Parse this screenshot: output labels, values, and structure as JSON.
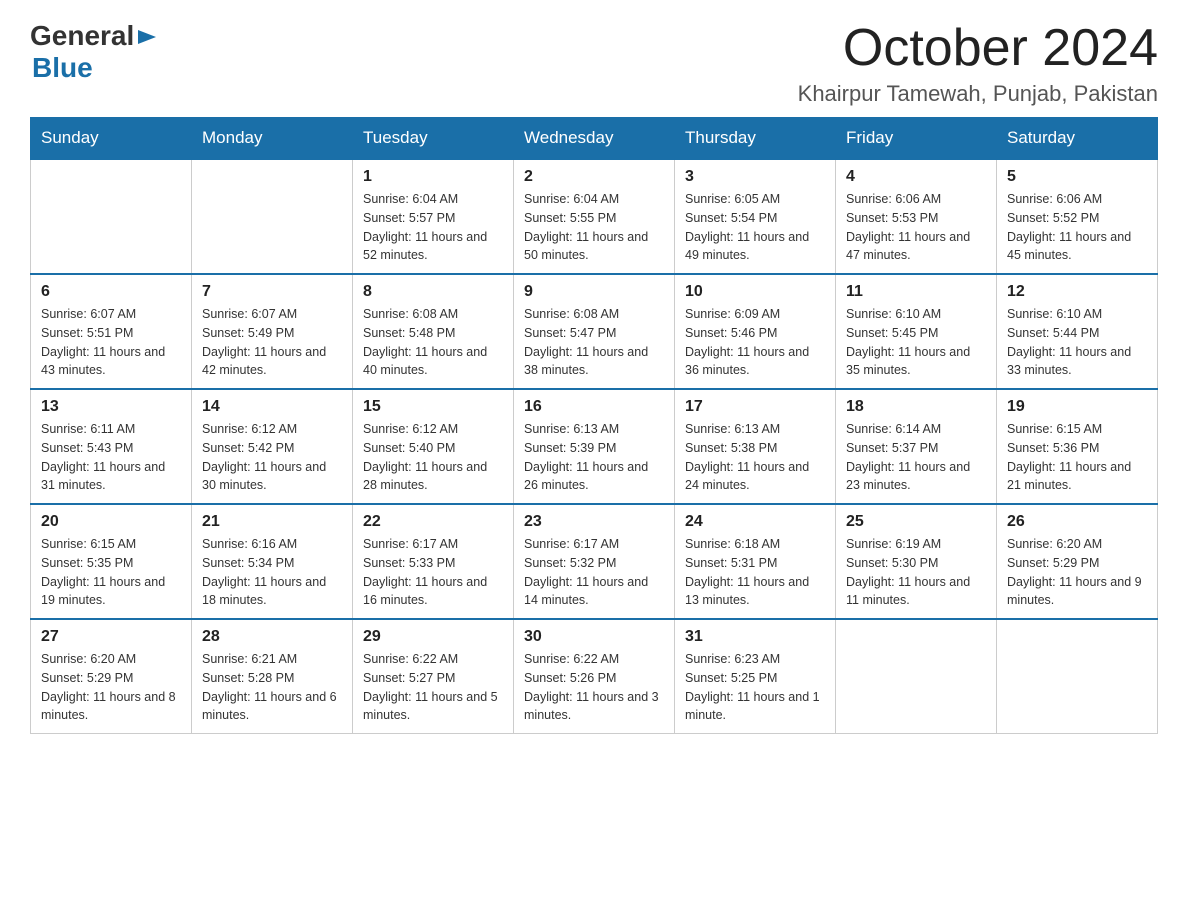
{
  "header": {
    "logo": {
      "general": "General",
      "arrow": "▶",
      "blue": "Blue"
    },
    "title": "October 2024",
    "location": "Khairpur Tamewah, Punjab, Pakistan"
  },
  "weekdays": [
    "Sunday",
    "Monday",
    "Tuesday",
    "Wednesday",
    "Thursday",
    "Friday",
    "Saturday"
  ],
  "weeks": [
    [
      {
        "day": "",
        "sunrise": "",
        "sunset": "",
        "daylight": ""
      },
      {
        "day": "",
        "sunrise": "",
        "sunset": "",
        "daylight": ""
      },
      {
        "day": "1",
        "sunrise": "Sunrise: 6:04 AM",
        "sunset": "Sunset: 5:57 PM",
        "daylight": "Daylight: 11 hours and 52 minutes."
      },
      {
        "day": "2",
        "sunrise": "Sunrise: 6:04 AM",
        "sunset": "Sunset: 5:55 PM",
        "daylight": "Daylight: 11 hours and 50 minutes."
      },
      {
        "day": "3",
        "sunrise": "Sunrise: 6:05 AM",
        "sunset": "Sunset: 5:54 PM",
        "daylight": "Daylight: 11 hours and 49 minutes."
      },
      {
        "day": "4",
        "sunrise": "Sunrise: 6:06 AM",
        "sunset": "Sunset: 5:53 PM",
        "daylight": "Daylight: 11 hours and 47 minutes."
      },
      {
        "day": "5",
        "sunrise": "Sunrise: 6:06 AM",
        "sunset": "Sunset: 5:52 PM",
        "daylight": "Daylight: 11 hours and 45 minutes."
      }
    ],
    [
      {
        "day": "6",
        "sunrise": "Sunrise: 6:07 AM",
        "sunset": "Sunset: 5:51 PM",
        "daylight": "Daylight: 11 hours and 43 minutes."
      },
      {
        "day": "7",
        "sunrise": "Sunrise: 6:07 AM",
        "sunset": "Sunset: 5:49 PM",
        "daylight": "Daylight: 11 hours and 42 minutes."
      },
      {
        "day": "8",
        "sunrise": "Sunrise: 6:08 AM",
        "sunset": "Sunset: 5:48 PM",
        "daylight": "Daylight: 11 hours and 40 minutes."
      },
      {
        "day": "9",
        "sunrise": "Sunrise: 6:08 AM",
        "sunset": "Sunset: 5:47 PM",
        "daylight": "Daylight: 11 hours and 38 minutes."
      },
      {
        "day": "10",
        "sunrise": "Sunrise: 6:09 AM",
        "sunset": "Sunset: 5:46 PM",
        "daylight": "Daylight: 11 hours and 36 minutes."
      },
      {
        "day": "11",
        "sunrise": "Sunrise: 6:10 AM",
        "sunset": "Sunset: 5:45 PM",
        "daylight": "Daylight: 11 hours and 35 minutes."
      },
      {
        "day": "12",
        "sunrise": "Sunrise: 6:10 AM",
        "sunset": "Sunset: 5:44 PM",
        "daylight": "Daylight: 11 hours and 33 minutes."
      }
    ],
    [
      {
        "day": "13",
        "sunrise": "Sunrise: 6:11 AM",
        "sunset": "Sunset: 5:43 PM",
        "daylight": "Daylight: 11 hours and 31 minutes."
      },
      {
        "day": "14",
        "sunrise": "Sunrise: 6:12 AM",
        "sunset": "Sunset: 5:42 PM",
        "daylight": "Daylight: 11 hours and 30 minutes."
      },
      {
        "day": "15",
        "sunrise": "Sunrise: 6:12 AM",
        "sunset": "Sunset: 5:40 PM",
        "daylight": "Daylight: 11 hours and 28 minutes."
      },
      {
        "day": "16",
        "sunrise": "Sunrise: 6:13 AM",
        "sunset": "Sunset: 5:39 PM",
        "daylight": "Daylight: 11 hours and 26 minutes."
      },
      {
        "day": "17",
        "sunrise": "Sunrise: 6:13 AM",
        "sunset": "Sunset: 5:38 PM",
        "daylight": "Daylight: 11 hours and 24 minutes."
      },
      {
        "day": "18",
        "sunrise": "Sunrise: 6:14 AM",
        "sunset": "Sunset: 5:37 PM",
        "daylight": "Daylight: 11 hours and 23 minutes."
      },
      {
        "day": "19",
        "sunrise": "Sunrise: 6:15 AM",
        "sunset": "Sunset: 5:36 PM",
        "daylight": "Daylight: 11 hours and 21 minutes."
      }
    ],
    [
      {
        "day": "20",
        "sunrise": "Sunrise: 6:15 AM",
        "sunset": "Sunset: 5:35 PM",
        "daylight": "Daylight: 11 hours and 19 minutes."
      },
      {
        "day": "21",
        "sunrise": "Sunrise: 6:16 AM",
        "sunset": "Sunset: 5:34 PM",
        "daylight": "Daylight: 11 hours and 18 minutes."
      },
      {
        "day": "22",
        "sunrise": "Sunrise: 6:17 AM",
        "sunset": "Sunset: 5:33 PM",
        "daylight": "Daylight: 11 hours and 16 minutes."
      },
      {
        "day": "23",
        "sunrise": "Sunrise: 6:17 AM",
        "sunset": "Sunset: 5:32 PM",
        "daylight": "Daylight: 11 hours and 14 minutes."
      },
      {
        "day": "24",
        "sunrise": "Sunrise: 6:18 AM",
        "sunset": "Sunset: 5:31 PM",
        "daylight": "Daylight: 11 hours and 13 minutes."
      },
      {
        "day": "25",
        "sunrise": "Sunrise: 6:19 AM",
        "sunset": "Sunset: 5:30 PM",
        "daylight": "Daylight: 11 hours and 11 minutes."
      },
      {
        "day": "26",
        "sunrise": "Sunrise: 6:20 AM",
        "sunset": "Sunset: 5:29 PM",
        "daylight": "Daylight: 11 hours and 9 minutes."
      }
    ],
    [
      {
        "day": "27",
        "sunrise": "Sunrise: 6:20 AM",
        "sunset": "Sunset: 5:29 PM",
        "daylight": "Daylight: 11 hours and 8 minutes."
      },
      {
        "day": "28",
        "sunrise": "Sunrise: 6:21 AM",
        "sunset": "Sunset: 5:28 PM",
        "daylight": "Daylight: 11 hours and 6 minutes."
      },
      {
        "day": "29",
        "sunrise": "Sunrise: 6:22 AM",
        "sunset": "Sunset: 5:27 PM",
        "daylight": "Daylight: 11 hours and 5 minutes."
      },
      {
        "day": "30",
        "sunrise": "Sunrise: 6:22 AM",
        "sunset": "Sunset: 5:26 PM",
        "daylight": "Daylight: 11 hours and 3 minutes."
      },
      {
        "day": "31",
        "sunrise": "Sunrise: 6:23 AM",
        "sunset": "Sunset: 5:25 PM",
        "daylight": "Daylight: 11 hours and 1 minute."
      },
      {
        "day": "",
        "sunrise": "",
        "sunset": "",
        "daylight": ""
      },
      {
        "day": "",
        "sunrise": "",
        "sunset": "",
        "daylight": ""
      }
    ]
  ]
}
